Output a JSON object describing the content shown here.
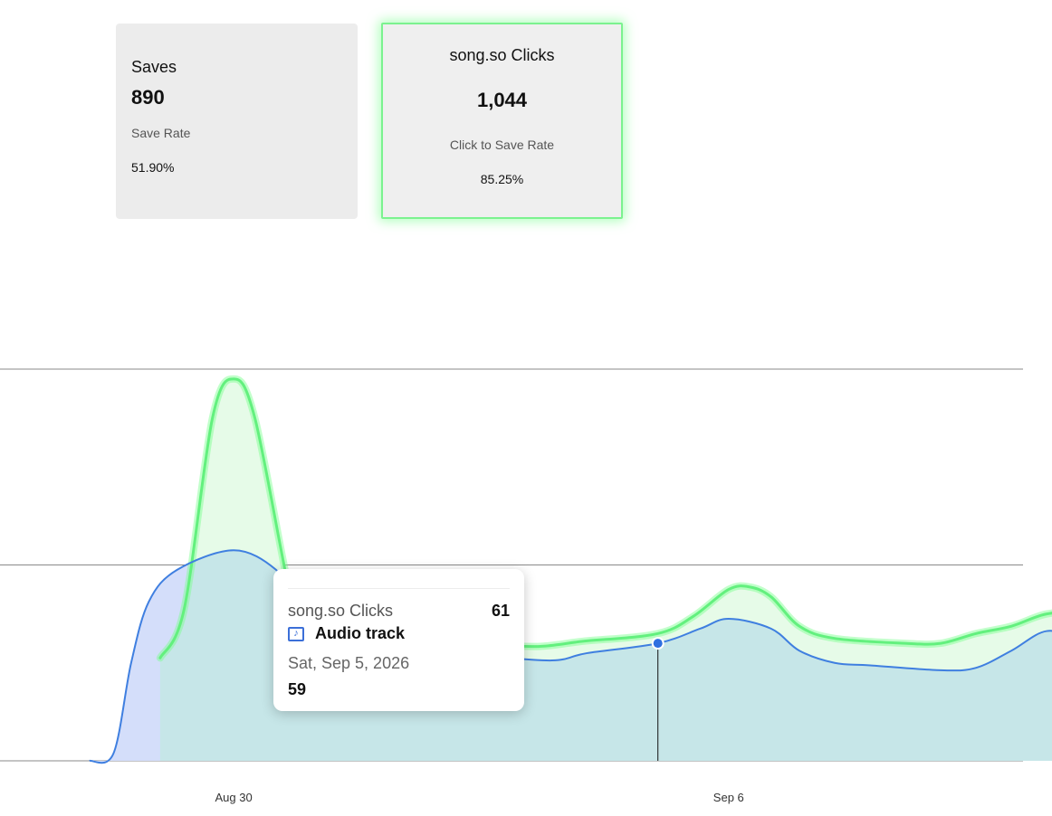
{
  "cards": {
    "saves": {
      "title": "Saves",
      "value": "890",
      "sub_label": "Save Rate",
      "sub_value": "51.90%"
    },
    "clicks": {
      "title": "song.so Clicks",
      "value": "1,044",
      "sub_label": "Click to Save Rate",
      "sub_value": "85.25%"
    }
  },
  "tooltip": {
    "series_label": "song.so Clicks",
    "series_value": "61",
    "track_icon": "music-note-icon",
    "track_name": "Audio track",
    "date": "Sat, Sep 5, 2026",
    "value": "59"
  },
  "chart_data": {
    "type": "area",
    "x_ticks": [
      {
        "label": "Aug 30",
        "x": 1.0
      },
      {
        "label": "Sep 6",
        "x": 8.0
      }
    ],
    "ylim": [
      0,
      160
    ],
    "y_gridlines": [
      0,
      80,
      160
    ],
    "grid": true,
    "legend": "none",
    "colors": {
      "saves": "#3f7fe0",
      "clicks": "#63f07e",
      "saves_fill": "#d4defa",
      "overlap_fill": "#c6e6e8",
      "clicks_fill": "#e6fbe8"
    },
    "series": [
      {
        "key": "saves",
        "points": [
          [
            -1.04,
            0
          ],
          [
            -0.7,
            3
          ],
          [
            -0.45,
            40
          ],
          [
            -0.2,
            65
          ],
          [
            0.2,
            78
          ],
          [
            1.0,
            86
          ],
          [
            1.6,
            78
          ],
          [
            2.0,
            62
          ],
          [
            2.5,
            55
          ],
          [
            3.0,
            49
          ],
          [
            3.6,
            45
          ],
          [
            4.5,
            43
          ],
          [
            5.5,
            41
          ],
          [
            6.0,
            44
          ],
          [
            7.0,
            48
          ],
          [
            7.6,
            54
          ],
          [
            8.0,
            58
          ],
          [
            8.6,
            54
          ],
          [
            9.0,
            45
          ],
          [
            9.5,
            40
          ],
          [
            10.0,
            39
          ],
          [
            11.0,
            37
          ],
          [
            11.5,
            38
          ],
          [
            12.0,
            45
          ],
          [
            12.5,
            53
          ],
          [
            13.0,
            49
          ],
          [
            13.5,
            42
          ],
          [
            14.0,
            41
          ],
          [
            14.5,
            47
          ],
          [
            15.0,
            59
          ]
        ]
      },
      {
        "key": "clicks",
        "points": [
          [
            -0.04,
            42
          ],
          [
            0.3,
            62
          ],
          [
            0.7,
            140
          ],
          [
            1.0,
            156
          ],
          [
            1.3,
            140
          ],
          [
            1.8,
            68
          ],
          [
            2.0,
            58
          ],
          [
            2.5,
            54
          ],
          [
            3.0,
            58
          ],
          [
            3.5,
            56
          ],
          [
            5.0,
            47
          ],
          [
            6.0,
            49
          ],
          [
            7.0,
            52
          ],
          [
            7.5,
            59
          ],
          [
            8.0,
            70
          ],
          [
            8.3,
            71
          ],
          [
            8.6,
            67
          ],
          [
            9.0,
            55
          ],
          [
            9.5,
            50
          ],
          [
            10.5,
            48
          ],
          [
            11.0,
            48
          ],
          [
            11.5,
            52
          ],
          [
            12.0,
            55
          ],
          [
            12.5,
            60
          ],
          [
            13.0,
            60
          ],
          [
            13.5,
            51
          ],
          [
            14.0,
            48
          ],
          [
            14.5,
            59
          ],
          [
            15.0,
            66
          ]
        ]
      }
    ],
    "highlight": {
      "series": "saves",
      "x": 7.0,
      "y": 48
    }
  }
}
